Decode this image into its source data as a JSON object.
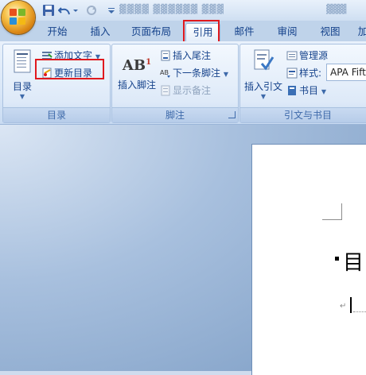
{
  "tabs": [
    "开始",
    "插入",
    "页面布局",
    "引用",
    "邮件",
    "审阅",
    "视图",
    "加"
  ],
  "active_tab": "引用",
  "groups": {
    "toc": {
      "label": "目录",
      "toc_button": "目录",
      "add_text": "添加文字",
      "update_toc": "更新目录"
    },
    "footnotes": {
      "label": "脚注",
      "insert_footnote": "插入脚注",
      "footnote_icon_text": "AB",
      "footnote_icon_sup": "1",
      "insert_endnote": "插入尾注",
      "next_footnote": "下一条脚注",
      "show_notes": "显示备注"
    },
    "citations": {
      "label": "引文与书目",
      "insert_citation": "插入引文",
      "manage_sources": "管理源",
      "style_label": "样式:",
      "style_value": "APA Fift",
      "bibliography": "书目"
    }
  },
  "document": {
    "heading": "目"
  },
  "colors": {
    "highlight": "#e0191e",
    "ribbon_text": "#15428b"
  }
}
